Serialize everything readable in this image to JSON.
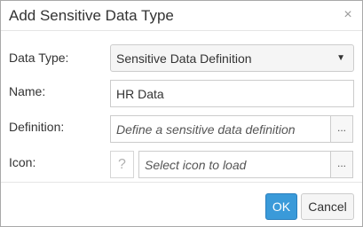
{
  "dialog": {
    "title": "Add Sensitive Data Type",
    "close_glyph": "×"
  },
  "form": {
    "data_type": {
      "label": "Data Type:",
      "value": "Sensitive Data Definition",
      "caret": "▼"
    },
    "name": {
      "label": "Name:",
      "value": "HR Data"
    },
    "definition": {
      "label": "Definition:",
      "placeholder": "Define a sensitive data definition",
      "browse": "..."
    },
    "icon": {
      "label": "Icon:",
      "preview": "?",
      "placeholder": "Select icon to load",
      "browse": "..."
    }
  },
  "footer": {
    "ok_label": "OK",
    "cancel_label": "Cancel"
  },
  "colors": {
    "accent": "#3a9ad9",
    "border": "#cccccc"
  },
  "icons": [
    "close-icon",
    "chevron-down-icon",
    "question-mark-icon"
  ]
}
